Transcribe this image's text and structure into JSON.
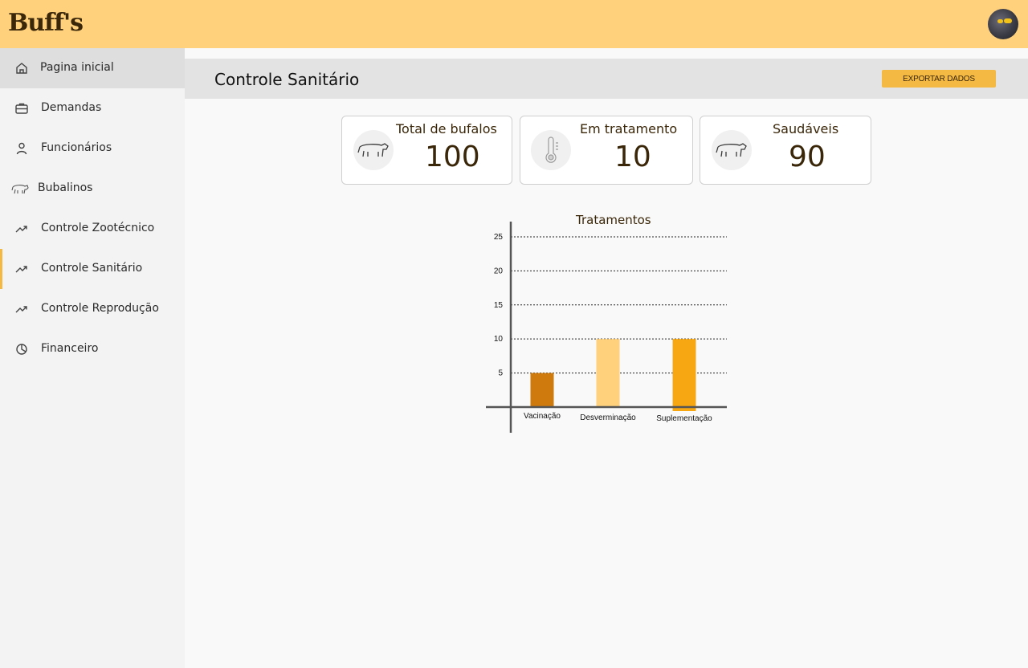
{
  "app": {
    "logo": "Buff's"
  },
  "colors": {
    "topbar": "#ffd17c",
    "accent": "#f4b943",
    "text_dark": "#3a2608"
  },
  "sidebar": {
    "items": [
      {
        "label": "Pagina inicial",
        "icon": "home-icon"
      },
      {
        "label": "Demandas",
        "icon": "briefcase-icon"
      },
      {
        "label": "Funcionários",
        "icon": "user-icon"
      },
      {
        "label": "Bubalinos",
        "icon": "buffalo-icon"
      },
      {
        "label": "Controle Zootécnico",
        "icon": "trend-up-icon"
      },
      {
        "label": "Controle Sanitário",
        "icon": "trend-up-icon"
      },
      {
        "label": "Controle Reprodução",
        "icon": "trend-up-icon"
      },
      {
        "label": "Financeiro",
        "icon": "pie-chart-icon"
      }
    ],
    "active_item": "Controle Sanitário"
  },
  "header": {
    "title": "Controle Sanitário",
    "export_label": "EXPORTAR DADOS"
  },
  "cards": [
    {
      "title": "Total de bufalos",
      "value": "100",
      "icon": "buffalo-icon"
    },
    {
      "title": "Em tratamento",
      "value": "10",
      "icon": "thermometer-icon"
    },
    {
      "title": "Saudáveis",
      "value": "90",
      "icon": "buffalo-icon"
    }
  ],
  "chart_data": {
    "type": "bar",
    "title": "Tratamentos",
    "categories": [
      "Vacinação",
      "Desverminação",
      "Suplementação"
    ],
    "values": [
      5,
      10,
      10
    ],
    "colors": [
      "#cf7a0d",
      "#ffd17c",
      "#f7a712"
    ],
    "yticks": [
      5,
      10,
      15,
      20,
      25
    ],
    "ylim": [
      0,
      27
    ],
    "grid": true
  }
}
